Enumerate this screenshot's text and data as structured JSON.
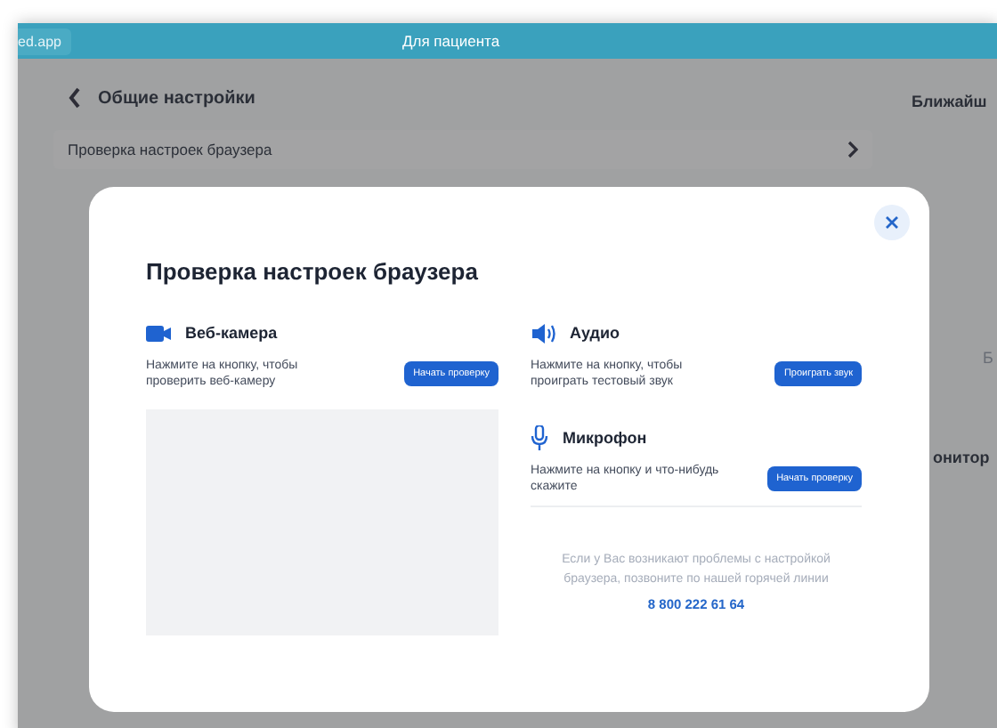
{
  "window": {
    "address": "ed.app",
    "title": "Для пациента"
  },
  "page": {
    "heading": "Общие настройки",
    "settings_row": "Проверка настроек браузера",
    "right_heading": "Ближайш",
    "right_text": "Б",
    "right_section": "онитор"
  },
  "dialog": {
    "title": "Проверка настроек браузера",
    "sections": [
      {
        "kind": "camera",
        "title": "Веб-камера",
        "text": "Нажмите на кнопку, чтобы проверить веб-камеру",
        "button": "Начать проверку"
      },
      {
        "kind": "audio",
        "title": "Аудио",
        "text": "Нажмите на кнопку, чтобы проиграть тестовый звук",
        "button": "Проиграть звук"
      },
      {
        "kind": "mic",
        "title": "Микрофон",
        "text": "Нажмите на кнопку и что-нибудь скажите",
        "button": "Начать проверку"
      }
    ],
    "help": "Если у Вас возникают проблемы с настройкой браузера, позвоните по нашей горячей линии",
    "phone": "8 800 222 61 64"
  }
}
